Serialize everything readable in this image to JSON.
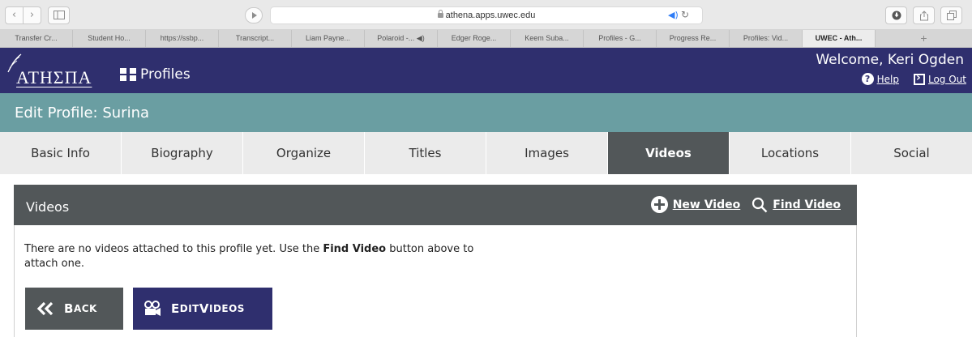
{
  "browser": {
    "url": "athena.apps.uwec.edu",
    "tabs": [
      {
        "label": "Transfer Cr...",
        "active": false
      },
      {
        "label": "Student Ho...",
        "active": false
      },
      {
        "label": "https://ssbp...",
        "active": false
      },
      {
        "label": "Transcript...",
        "active": false
      },
      {
        "label": "Liam Payne...",
        "active": false
      },
      {
        "label": "Polaroid -... ◀)",
        "active": false
      },
      {
        "label": "Edger Roge...",
        "active": false
      },
      {
        "label": "Keem Suba...",
        "active": false
      },
      {
        "label": "Profiles - G...",
        "active": false
      },
      {
        "label": "Progress Re...",
        "active": false
      },
      {
        "label": "Profiles: Vid...",
        "active": false
      },
      {
        "label": "UWEC - Ath...",
        "active": true
      }
    ],
    "new_tab_symbol": "+"
  },
  "header": {
    "logo_text": "ΑΤΗΣΠΑ",
    "app_name": "Profiles",
    "welcome": "Welcome, Keri Ogden",
    "help_label": "Help",
    "logout_label": "Log Out",
    "brand_color": "#2f2f6e"
  },
  "edit_bar": {
    "title": "Edit Profile: Surina",
    "color": "#6a9ea2"
  },
  "section_tabs": [
    {
      "label": "Basic Info",
      "active": false
    },
    {
      "label": "Biography",
      "active": false
    },
    {
      "label": "Organize",
      "active": false
    },
    {
      "label": "Titles",
      "active": false
    },
    {
      "label": "Images",
      "active": false
    },
    {
      "label": "Videos",
      "active": true
    },
    {
      "label": "Locations",
      "active": false
    },
    {
      "label": "Social",
      "active": false
    }
  ],
  "panel": {
    "title": "Videos",
    "new_video_label": "New Video",
    "find_video_label": "Find Video",
    "message_before": "There are no videos attached to this profile yet. Use the ",
    "message_bold": "Find Video",
    "message_after": " button above to attach one."
  },
  "buttons": {
    "back_first": "B",
    "back_rest": "ACK",
    "edit_first_1": "E",
    "edit_rest_1": "DIT ",
    "edit_first_2": "V",
    "edit_rest_2": "IDEOS"
  }
}
